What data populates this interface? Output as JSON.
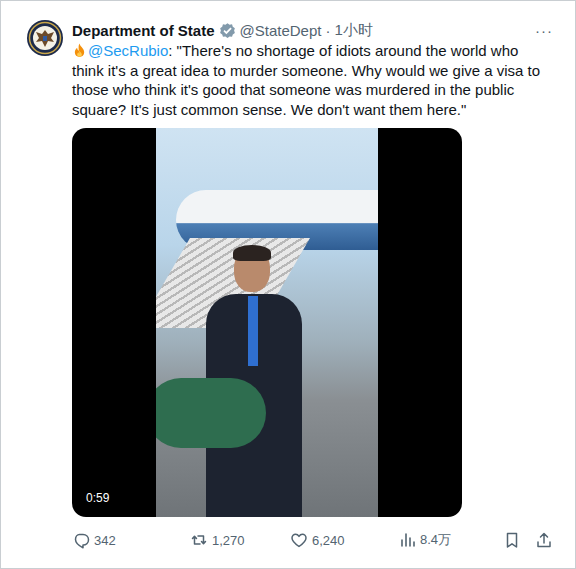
{
  "account": {
    "name": "Department of State",
    "verified": true,
    "handle": "@StateDept",
    "separator": "·",
    "time": "1小时"
  },
  "more": "···",
  "tweet": {
    "mention": "@SecRubio",
    "text": ": \"There's no shortage of idiots around the world who think it's a great idea to murder someone. Why would we give a visa to those who think it's good that someone was murdered in the public square? It's just common sense. We don't want them here.\""
  },
  "video": {
    "duration": "0:59"
  },
  "actions": [
    {
      "kind": "reply",
      "count": "342"
    },
    {
      "kind": "retweet",
      "count": "1,270"
    },
    {
      "kind": "like",
      "count": "6,240"
    },
    {
      "kind": "views",
      "count": "8.4万"
    }
  ],
  "tools": [
    {
      "kind": "bookmark"
    },
    {
      "kind": "share"
    }
  ]
}
